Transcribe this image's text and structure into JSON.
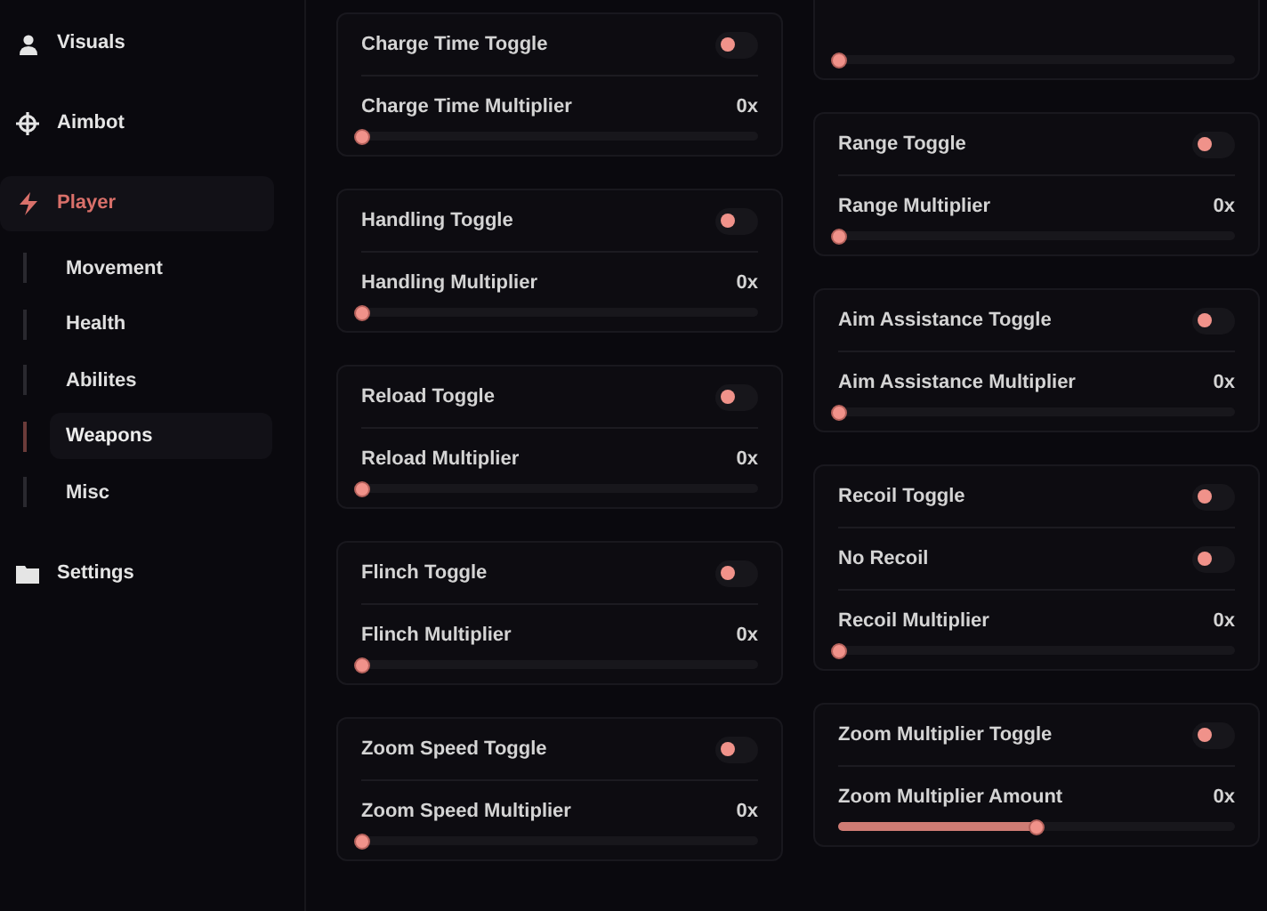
{
  "sidebar": {
    "items": [
      {
        "label": "Visuals",
        "kind": "person",
        "selected": false
      },
      {
        "label": "Aimbot",
        "kind": "crosshair",
        "selected": false
      },
      {
        "label": "Player",
        "kind": "bolt",
        "selected": true,
        "children": [
          {
            "label": "Movement",
            "selected": false
          },
          {
            "label": "Health",
            "selected": false
          },
          {
            "label": "Abilites",
            "selected": false
          },
          {
            "label": "Weapons",
            "selected": true
          },
          {
            "label": "Misc",
            "selected": false
          }
        ]
      },
      {
        "label": "Settings",
        "kind": "folder",
        "selected": false
      }
    ]
  },
  "columns": [
    {
      "cards": [
        {
          "rows": [
            {
              "kind": "toggle",
              "label": "Charge Time Toggle",
              "on": false
            },
            {
              "kind": "slider",
              "label": "Charge Time Multiplier",
              "reading": "0x",
              "level": 0
            }
          ]
        },
        {
          "rows": [
            {
              "kind": "toggle",
              "label": "Handling Toggle",
              "on": false
            },
            {
              "kind": "slider",
              "label": "Handling Multiplier",
              "reading": "0x",
              "level": 0
            }
          ]
        },
        {
          "rows": [
            {
              "kind": "toggle",
              "label": "Reload Toggle",
              "on": false
            },
            {
              "kind": "slider",
              "label": "Reload Multiplier",
              "reading": "0x",
              "level": 0
            }
          ]
        },
        {
          "rows": [
            {
              "kind": "toggle",
              "label": "Flinch Toggle",
              "on": false
            },
            {
              "kind": "slider",
              "label": "Flinch Multiplier",
              "reading": "0x",
              "level": 0
            }
          ]
        },
        {
          "rows": [
            {
              "kind": "toggle",
              "label": "Zoom Speed Toggle",
              "on": false
            },
            {
              "kind": "slider",
              "label": "Zoom Speed Multiplier",
              "reading": "0x",
              "level": 0
            }
          ]
        }
      ]
    },
    {
      "cards": [
        {
          "rows": [
            {
              "kind": "slider",
              "level": 0
            }
          ]
        },
        {
          "rows": [
            {
              "kind": "toggle",
              "label": "Range Toggle",
              "on": false
            },
            {
              "kind": "slider",
              "label": "Range Multiplier",
              "reading": "0x",
              "level": 0
            }
          ]
        },
        {
          "rows": [
            {
              "kind": "toggle",
              "label": "Aim Assistance Toggle",
              "on": false
            },
            {
              "kind": "slider",
              "label": "Aim Assistance Multiplier",
              "reading": "0x",
              "level": 0
            }
          ]
        },
        {
          "rows": [
            {
              "kind": "toggle",
              "label": "Recoil Toggle",
              "on": false
            },
            {
              "kind": "toggle",
              "label": "No Recoil",
              "on": false
            },
            {
              "kind": "slider",
              "label": "Recoil Multiplier",
              "reading": "0x",
              "level": 0
            }
          ]
        },
        {
          "rows": [
            {
              "kind": "toggle",
              "label": "Zoom Multiplier Toggle",
              "on": false
            },
            {
              "kind": "slider",
              "label": "Zoom Multiplier Amount",
              "reading": "0x",
              "level": 0.5
            }
          ]
        }
      ]
    }
  ]
}
